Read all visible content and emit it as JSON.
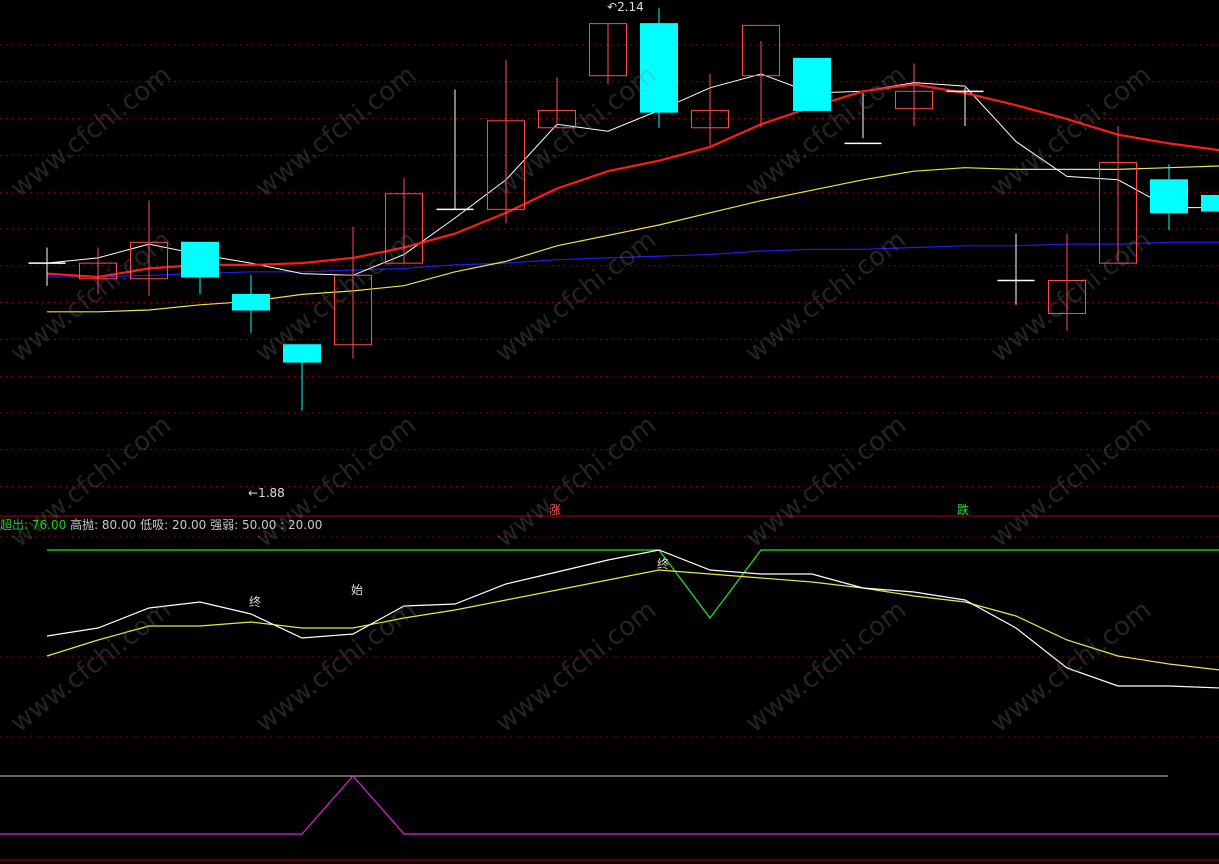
{
  "colors": {
    "background": "#000000",
    "up_candle": "#ff4b4b",
    "down_candle": "#00ffff",
    "doji": "#ffffff",
    "ma_white": "#ffffff",
    "ma_red": "#ff1a1a",
    "ma_yellow": "#e6e64a",
    "ma_blue": "#1e1ee8",
    "grid": "#9a0000",
    "osc_white": "#ffffff",
    "osc_yellow": "#e6e64a",
    "osc_green": "#1ee81e",
    "bottom_magenta": "#e020e0",
    "bottom_white": "#ffffff"
  },
  "watermark": "www.cfchi.com",
  "price_labels": {
    "high": "2.14",
    "low": "1.88"
  },
  "signals": {
    "up": "涨",
    "down": "跌"
  },
  "indicator_header": {
    "item1_label": "超出:",
    "item1_value": "76.00",
    "item2": "高抛: 80.00",
    "item3": "低吸: 20.00",
    "item4": "强弱: 50.00 : 20.00"
  },
  "osc_marks": {
    "end1": "终",
    "start": "始",
    "end2": "终"
  },
  "chart_data": {
    "type": "candlestick",
    "price_range": [
      1.86,
      2.14
    ],
    "candles": [
      {
        "o": 1.993,
        "h": 2.002,
        "l": 1.98,
        "c": 1.993
      },
      {
        "o": 1.984,
        "h": 2.002,
        "l": 1.975,
        "c": 1.993
      },
      {
        "o": 1.984,
        "h": 2.029,
        "l": 1.974,
        "c": 2.005
      },
      {
        "o": 2.005,
        "h": 2.005,
        "l": 1.975,
        "c": 1.985
      },
      {
        "o": 1.975,
        "h": 1.986,
        "l": 1.953,
        "c": 1.966
      },
      {
        "o": 1.946,
        "h": 1.946,
        "l": 1.908,
        "c": 1.936
      },
      {
        "o": 1.946,
        "h": 2.014,
        "l": 1.938,
        "c": 1.986
      },
      {
        "o": 1.993,
        "h": 2.042,
        "l": 1.993,
        "c": 2.033
      },
      {
        "o": 2.024,
        "h": 2.093,
        "l": 2.024,
        "c": 2.024
      },
      {
        "o": 2.024,
        "h": 2.11,
        "l": 2.016,
        "c": 2.075
      },
      {
        "o": 2.071,
        "h": 2.1,
        "l": 2.071,
        "c": 2.081
      },
      {
        "o": 2.101,
        "h": 2.131,
        "l": 2.096,
        "c": 2.131
      },
      {
        "o": 2.131,
        "h": 2.14,
        "l": 2.071,
        "c": 2.08
      },
      {
        "o": 2.071,
        "h": 2.102,
        "l": 2.061,
        "c": 2.081
      },
      {
        "o": 2.101,
        "h": 2.121,
        "l": 2.071,
        "c": 2.13
      },
      {
        "o": 2.111,
        "h": 2.111,
        "l": 2.091,
        "c": 2.081
      },
      {
        "o": 2.062,
        "h": 2.091,
        "l": 2.065,
        "c": 2.062
      },
      {
        "o": 2.082,
        "h": 2.108,
        "l": 2.072,
        "c": 2.092
      },
      {
        "o": 2.092,
        "h": 2.094,
        "l": 2.072,
        "c": 2.092
      },
      {
        "o": 1.983,
        "h": 2.01,
        "l": 1.969,
        "c": 1.983
      },
      {
        "o": 1.964,
        "h": 2.01,
        "l": 1.954,
        "c": 1.983
      },
      {
        "o": 1.993,
        "h": 2.072,
        "l": 1.994,
        "c": 2.051
      },
      {
        "o": 2.041,
        "h": 2.05,
        "l": 2.012,
        "c": 2.022
      },
      {
        "o": 2.032,
        "h": 2.033,
        "l": 2.02,
        "c": 2.023
      }
    ],
    "ma_white": [
      1.993,
      1.996,
      2.004,
      1.998,
      1.993,
      1.987,
      1.986,
      1.998,
      2.019,
      2.041,
      2.073,
      2.069,
      2.081,
      2.094,
      2.102,
      2.091,
      2.092,
      2.097,
      2.095,
      2.063,
      2.043,
      2.041,
      2.025,
      2.025
    ],
    "ma_red": [
      1.987,
      1.985,
      1.99,
      1.992,
      1.992,
      1.993,
      1.996,
      2.002,
      2.01,
      2.022,
      2.036,
      2.046,
      2.052,
      2.06,
      2.073,
      2.083,
      2.092,
      2.096,
      2.091,
      2.084,
      2.076,
      2.067,
      2.062,
      2.058
    ],
    "ma_yellow": [
      1.965,
      1.965,
      1.966,
      1.969,
      1.971,
      1.975,
      1.977,
      1.98,
      1.988,
      1.994,
      2.003,
      2.009,
      2.015,
      2.022,
      2.029,
      2.035,
      2.041,
      2.046,
      2.048,
      2.047,
      2.047,
      2.047,
      2.048,
      2.049
    ],
    "ma_blue": [
      1.985,
      1.985,
      1.986,
      1.987,
      1.988,
      1.988,
      1.989,
      1.99,
      1.992,
      1.993,
      1.995,
      1.996,
      1.997,
      1.998,
      2.0,
      2.001,
      2.001,
      2.002,
      2.003,
      2.003,
      2.004,
      2.004,
      2.005,
      2.005
    ],
    "oscillator": {
      "range": [
        0,
        100
      ],
      "white": [
        52,
        56,
        66,
        69,
        63,
        51,
        53,
        67,
        68,
        78,
        84,
        90,
        95,
        85,
        83,
        83,
        76,
        74,
        70,
        56,
        36,
        27,
        27,
        26
      ],
      "yellow": [
        42,
        50,
        57,
        57,
        59,
        56,
        56,
        61,
        65,
        70,
        75,
        80,
        85,
        83,
        81,
        79,
        76,
        72,
        69,
        62,
        50,
        42,
        38,
        35
      ],
      "green": [
        95,
        95,
        95,
        95,
        95,
        95,
        95,
        95,
        95,
        95,
        95,
        95,
        95,
        61,
        95,
        95,
        95,
        95,
        95,
        95,
        95,
        95,
        95,
        95
      ],
      "yellow_levels": [
        80,
        20
      ]
    },
    "bottom_signal": {
      "magenta": [
        0,
        0,
        0,
        0,
        0,
        0,
        1,
        0,
        0,
        0,
        0,
        0,
        0,
        0,
        0,
        0,
        0,
        0,
        0,
        0,
        0,
        0,
        0,
        0
      ]
    }
  }
}
